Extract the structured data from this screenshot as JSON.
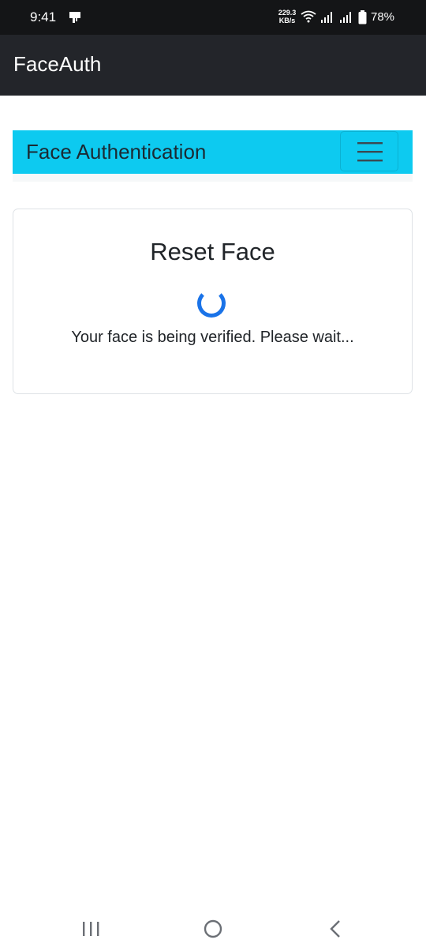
{
  "status_bar": {
    "time": "9:41",
    "net_speed_value": "229.3",
    "net_speed_unit": "KB/s",
    "battery": "78%",
    "icons": [
      "notification-icon",
      "wifi-icon",
      "signal-icon",
      "signal-icon",
      "battery-icon"
    ]
  },
  "app_bar": {
    "title": "FaceAuth"
  },
  "navbar": {
    "brand": "Face Authentication",
    "toggler_icon": "hamburger-icon",
    "color": "#0dcaf0"
  },
  "card": {
    "title": "Reset Face",
    "message": "Your face is being verified. Please wait...",
    "spinner_color": "#1a73e8"
  },
  "system_nav": {
    "icons": [
      "recents-icon",
      "home-icon",
      "back-icon"
    ]
  }
}
